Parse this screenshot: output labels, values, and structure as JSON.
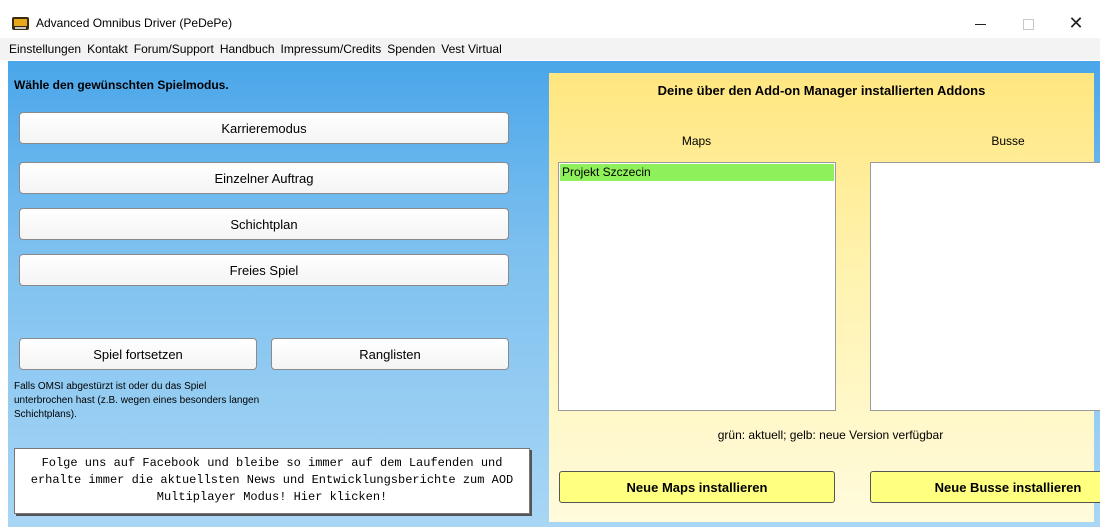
{
  "window": {
    "title": "Advanced Omnibus Driver (PeDePe)",
    "controls": {
      "minimize": "minimize-icon",
      "maximize": "maximize-icon",
      "close": "close-icon",
      "close_glyph": "✕"
    }
  },
  "menu": [
    "Einstellungen",
    "Kontakt",
    "Forum/Support",
    "Handbuch",
    "Impressum/Credits",
    "Spenden",
    "Vest Virtual"
  ],
  "main": {
    "heading": "Wähle den gewünschten Spielmodus.",
    "modes": [
      "Karrieremodus",
      "Einzelner Auftrag",
      "Schichtplan",
      "Freies Spiel"
    ],
    "continue_button": "Spiel fortsetzen",
    "leaderboard_button": "Ranglisten",
    "continue_note": "Falls OMSI abgestürzt ist oder du das Spiel unterbrochen hast (z.B. wegen eines besonders langen Schichtplans).",
    "facebook_text": "Folge uns auf Facebook und bleibe so immer auf dem Laufenden und erhalte immer die aktuellsten News und Entwicklungsberichte zum AOD Multiplayer Modus! Hier klicken!"
  },
  "addons": {
    "title": "Deine über den Add-on Manager installierten Addons",
    "maps_label": "Maps",
    "busse_label": "Busse",
    "maps": [
      "Projekt Szczecin"
    ],
    "busse": [],
    "legend": "grün: aktuell;   gelb: neue Version verfügbar",
    "install_maps": "Neue Maps installieren",
    "install_busse": "Neue Busse installieren"
  },
  "colors": {
    "panel_yellow": "#ffe680",
    "current_green": "#8ef05a",
    "install_button": "#ffff80",
    "background_blue": "#4aa6ea"
  }
}
